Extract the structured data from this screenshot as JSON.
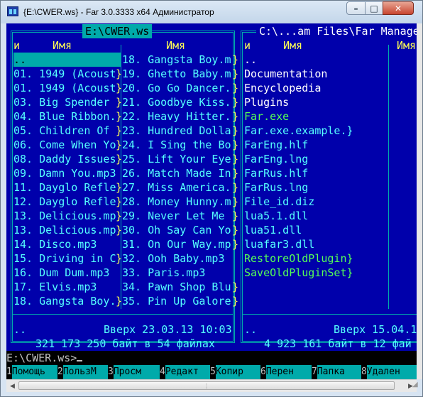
{
  "window": {
    "title": "{E:\\CWER.ws} - Far 3.0.3333 x64 Администратор",
    "icon": "far-manager-icon",
    "buttons": {
      "minimize": "–",
      "maximize": "□",
      "close": "✕"
    }
  },
  "left_panel": {
    "path": "E:\\CWER.ws",
    "col1_marker": "и",
    "col1_header": "Имя",
    "col2_header": "Имя",
    "col1": [
      "..",
      "01. 1949 (Acoust",
      "01. 1949 (Acoust",
      "03. Big Spender ",
      "04. Blue Ribbon.",
      "05. Children Of ",
      "06. Come When Yo",
      "08. Daddy Issues",
      "09. Damn You.mp3",
      "11. Dayglo Refle",
      "12. Dayglo Refle",
      "13. Delicious.mp",
      "13. Delicious.mp",
      "14. Disco.mp3",
      "15. Driving in C",
      "16. Dum Dum.mp3",
      "17. Elvis.mp3",
      "18. Gangsta Boy."
    ],
    "col1_overflow": [
      "",
      "}",
      "}",
      "}",
      "}",
      "}",
      "}",
      "}",
      "",
      "}",
      "}",
      "}",
      "}",
      "",
      "}",
      "",
      "",
      "}"
    ],
    "col2": [
      "18. Gangsta Boy.m",
      "19. Ghetto Baby.m",
      "20. Go Go Dancer.",
      "21. Goodbye Kiss.",
      "22. Heavy Hitter.",
      "23. Hundred Dolla",
      "24. I Sing the Bo",
      "25. Lift Your Eye",
      "26. Match Made In",
      "27. Miss America.",
      "28. Money Hunny.m",
      "29. Never Let Me ",
      "30. Oh Say Can Yo",
      "31. On Our Way.mp",
      "32. Ooh Baby.mp3",
      "33. Paris.mp3",
      "34. Pawn Shop Blu",
      "35. Pin Up Galore"
    ],
    "col2_overflow": [
      "}",
      "}",
      "}",
      "}",
      "}",
      "}",
      "}",
      "}",
      "}",
      "}",
      "}",
      "}",
      "}",
      "}",
      "",
      "",
      "}",
      "}"
    ],
    "status_name": "..",
    "status_info": "Вверх 23.03.13 10:03",
    "summary": " 321 173 250 байт в 54 файлах "
  },
  "right_panel": {
    "path": "C:\\...am Files\\Far Manage",
    "col1_marker": "и",
    "col1_header": "Имя",
    "col2_header": "Имя",
    "items": [
      {
        "name": "..",
        "color": "#ffffff"
      },
      {
        "name": "Documentation",
        "color": "#ffffff"
      },
      {
        "name": "Encyclopedia",
        "color": "#ffffff"
      },
      {
        "name": "Plugins",
        "color": "#ffffff"
      },
      {
        "name": "Far.exe",
        "color": "#55ff55"
      },
      {
        "name": "Far.exe.example.}",
        "color": "#55ffff"
      },
      {
        "name": "FarEng.hlf",
        "color": "#55ffff"
      },
      {
        "name": "FarEng.lng",
        "color": "#55ffff"
      },
      {
        "name": "FarRus.hlf",
        "color": "#55ffff"
      },
      {
        "name": "FarRus.lng",
        "color": "#55ffff"
      },
      {
        "name": "File_id.diz",
        "color": "#55ffff"
      },
      {
        "name": "lua5.1.dll",
        "color": "#55ffff"
      },
      {
        "name": "lua51.dll",
        "color": "#55ffff"
      },
      {
        "name": "luafar3.dll",
        "color": "#55ffff"
      },
      {
        "name": "RestoreOldPlugin}",
        "color": "#55ff55"
      },
      {
        "name": "SaveOldPluginSet}",
        "color": "#55ff55"
      }
    ],
    "status_name": "..",
    "status_info": "Вверх 15.04.1",
    "summary": " 4 923 161 байт в 12 фай"
  },
  "command_line": {
    "prompt": "E:\\CWER.ws>"
  },
  "keybar": [
    {
      "num": "1",
      "label": "Помощь"
    },
    {
      "num": "2",
      "label": "ПользМ"
    },
    {
      "num": "3",
      "label": "Просм"
    },
    {
      "num": "4",
      "label": "Редакт"
    },
    {
      "num": "5",
      "label": "Копир"
    },
    {
      "num": "6",
      "label": "Перен"
    },
    {
      "num": "7",
      "label": "Папка"
    },
    {
      "num": "8",
      "label": "Удален"
    }
  ],
  "scrollbar": {
    "left_arrow": "◀",
    "right_arrow": "▶",
    "grip": "⋮"
  }
}
